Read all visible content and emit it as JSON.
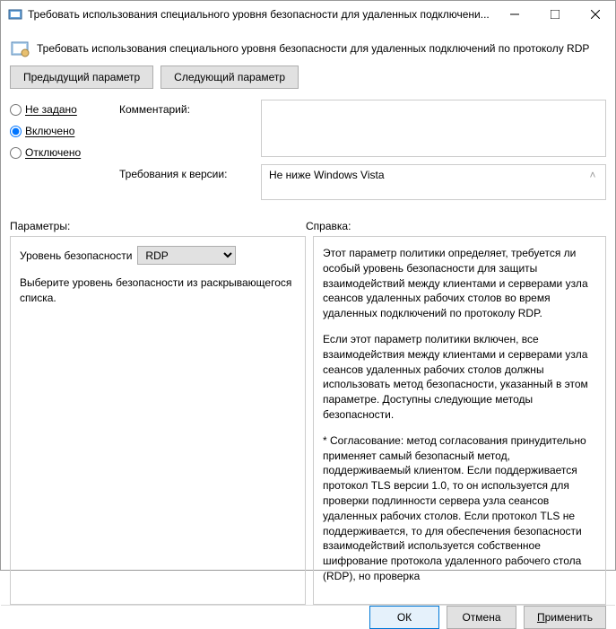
{
  "window": {
    "title": "Требовать использования специального уровня безопасности для удаленных подключени..."
  },
  "header": {
    "policy_title": "Требовать использования специального уровня безопасности для удаленных подключений по протоколу RDP"
  },
  "nav": {
    "prev": "Предыдущий параметр",
    "next": "Следующий параметр"
  },
  "state": {
    "not_configured": "Не задано",
    "enabled": "Включено",
    "disabled": "Отключено",
    "selected": "enabled"
  },
  "comment": {
    "label": "Комментарий:",
    "value": ""
  },
  "requirements": {
    "label": "Требования к версии:",
    "value": "Не ниже Windows Vista"
  },
  "panels": {
    "left_label": "Параметры:",
    "right_label": "Справка:"
  },
  "options": {
    "security_level_label": "Уровень безопасности",
    "security_level_value": "RDP",
    "hint": "Выберите уровень безопасности из раскрывающегося списка."
  },
  "help": {
    "p1": "Этот параметр политики определяет, требуется ли особый уровень безопасности для защиты взаимодействий между клиентами и серверами узла сеансов удаленных рабочих столов во время удаленных подключений по протоколу RDP.",
    "p2": "Если этот параметр политики включен, все взаимодействия между клиентами и серверами узла сеансов удаленных рабочих столов должны использовать метод безопасности, указанный в этом параметре. Доступны следующие методы безопасности.",
    "p3": "* Согласование: метод согласования принудительно применяет самый безопасный метод, поддерживаемый клиентом. Если поддерживается протокол TLS версии 1.0, то он используется для проверки подлинности сервера узла сеансов удаленных рабочих столов. Если протокол TLS не поддерживается, то для обеспечения безопасности взаимодействий используется собственное шифрование протокола удаленного рабочего стола (RDP), но проверка"
  },
  "footer": {
    "ok": "ОК",
    "cancel": "Отмена",
    "apply": "Применить"
  }
}
